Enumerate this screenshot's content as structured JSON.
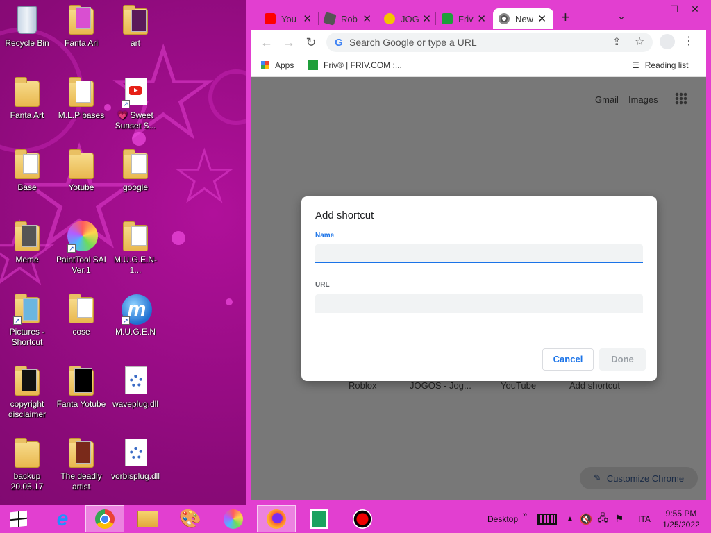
{
  "desktop": {
    "icons": [
      {
        "label": "Recycle Bin"
      },
      {
        "label": "Fanta Ari"
      },
      {
        "label": "art"
      },
      {
        "label": "Fanta Art"
      },
      {
        "label": "M.L.P bases"
      },
      {
        "label": "💗 Sweet Sunset S..."
      },
      {
        "label": "Base"
      },
      {
        "label": "Yotube"
      },
      {
        "label": "google"
      },
      {
        "label": "Meme"
      },
      {
        "label": "PaintTool SAI Ver.1"
      },
      {
        "label": "M.U.G.E.N-1..."
      },
      {
        "label": "Pictures - Shortcut"
      },
      {
        "label": "cose"
      },
      {
        "label": "M.U.G.E.N"
      },
      {
        "label": "copyright disclaimer"
      },
      {
        "label": "Fanta Yotube"
      },
      {
        "label": "waveplug.dll"
      },
      {
        "label": "backup 20.05.17"
      },
      {
        "label": "The deadly artist"
      },
      {
        "label": "vorbisplug.dll"
      }
    ]
  },
  "chrome": {
    "tabs": [
      {
        "label": "You"
      },
      {
        "label": "Rob"
      },
      {
        "label": "JOG"
      },
      {
        "label": "Friv"
      },
      {
        "label": "New"
      }
    ],
    "new_tab_symbol": "+",
    "tab_close_symbol": "✕",
    "window": {
      "minimize": "—",
      "maximize": "☐",
      "close": "✕",
      "tab_search": "⌄"
    },
    "omnibox": {
      "placeholder": "Search Google or type a URL",
      "g_logo": "G"
    },
    "bookmarks": {
      "apps": "Apps",
      "friv": "Friv® | FRIV.COM :...",
      "reading_list": "Reading list"
    },
    "ntp": {
      "gmail": "Gmail",
      "images": "Images",
      "shortcuts": [
        "Roblox",
        "JOGOS - Jog...",
        "YouTube",
        "Add shortcut"
      ],
      "customize": "Customize Chrome"
    },
    "dialog": {
      "title": "Add shortcut",
      "name_label": "Name",
      "name_value": "",
      "url_label": "URL",
      "url_value": "",
      "cancel": "Cancel",
      "done": "Done"
    }
  },
  "taskbar": {
    "desktop_label": "Desktop",
    "language": "ITA",
    "time": "9:55 PM",
    "date": "1/25/2022"
  },
  "colors": {
    "accent": "#e23fd0",
    "link_blue": "#1a73e8",
    "desktop_bg": "#8a0a78"
  }
}
